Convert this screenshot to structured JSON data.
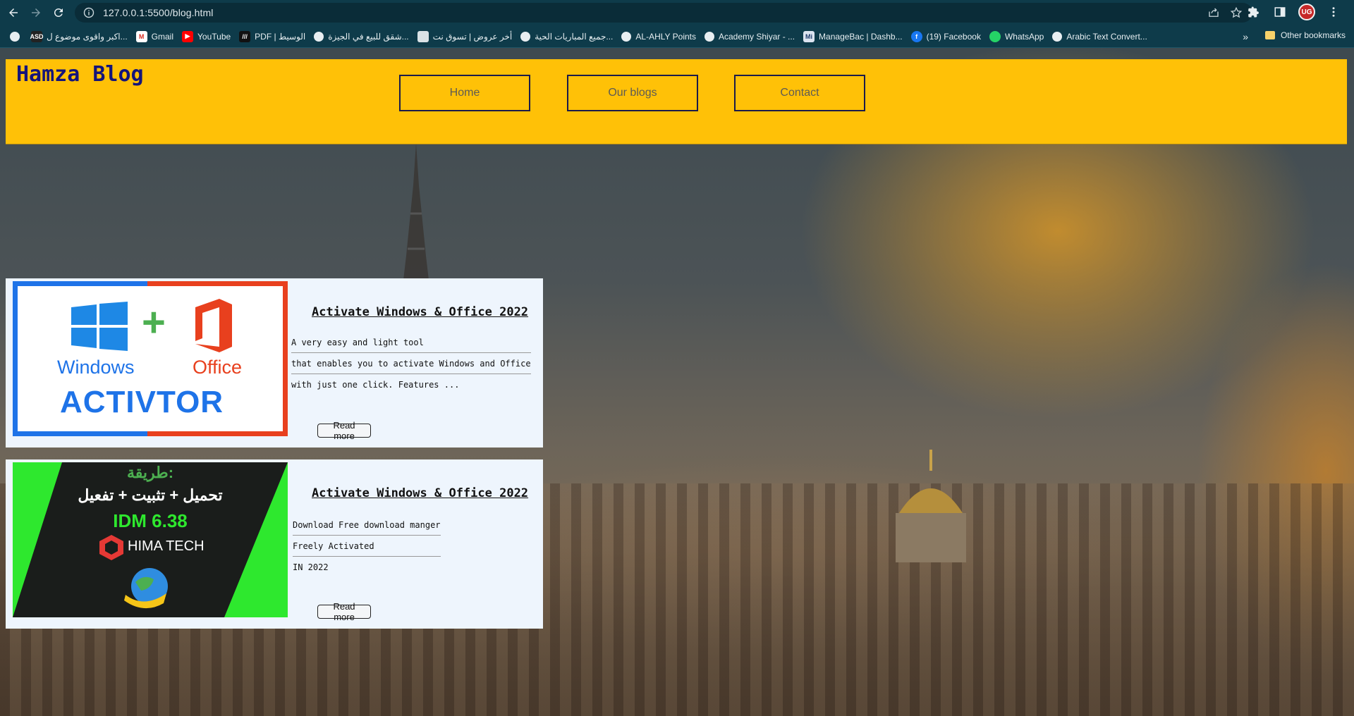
{
  "browser": {
    "url": "127.0.0.1:5500/blog.html",
    "avatar_initials": "UG",
    "bookmarks": [
      {
        "label": "",
        "icon": "globe-icon"
      },
      {
        "label": "اكبر واقوى موضوع ل...",
        "icon": "asd-icon"
      },
      {
        "label": "Gmail",
        "icon": "gmail-icon"
      },
      {
        "label": "YouTube",
        "icon": "youtube-icon"
      },
      {
        "label": "PDF | الوسيط",
        "icon": "wasset-icon"
      },
      {
        "label": "شقق للبيع في الجيزة...",
        "icon": "globe-icon"
      },
      {
        "label": "أخر عروض | تسوق نت",
        "icon": "page-icon"
      },
      {
        "label": "جميع المباريات الحية...",
        "icon": "globe-icon"
      },
      {
        "label": "AL-AHLY Points",
        "icon": "globe-icon"
      },
      {
        "label": "Academy Shiyar - ...",
        "icon": "globe-icon"
      },
      {
        "label": "ManageBac | Dashb...",
        "icon": "managebac-icon"
      },
      {
        "label": "(19) Facebook",
        "icon": "facebook-icon"
      },
      {
        "label": "WhatsApp",
        "icon": "whatsapp-icon"
      },
      {
        "label": "Arabic Text Convert...",
        "icon": "globe-icon"
      }
    ],
    "more_label": "»",
    "other_bookmarks": "Other bookmarks"
  },
  "site": {
    "title": "Hamza Blog",
    "nav": [
      "Home",
      "Our blogs",
      "Contact"
    ],
    "header_color": "#ffc107"
  },
  "posts": [
    {
      "title": "Activate Windows & Office 2022",
      "lines": [
        "A very easy and light tool",
        "that enables you to activate Windows and Office",
        "with just one click. Features ..."
      ],
      "read_more": "Read more",
      "image": {
        "brand_left": "Windows",
        "brand_right": "Office",
        "banner": "ACTIVTOR",
        "plus": "+"
      }
    },
    {
      "title": "Activate Windows & Office 2022",
      "lines": [
        "Download Free download manger",
        "Freely Activated",
        "IN 2022"
      ],
      "read_more": "Read more",
      "image": {
        "line1": "طريقة:",
        "line2": "تحميل + تثبيت + تفعيل",
        "line3": "IDM 6.38",
        "brand": "HIMA TECH"
      }
    }
  ]
}
